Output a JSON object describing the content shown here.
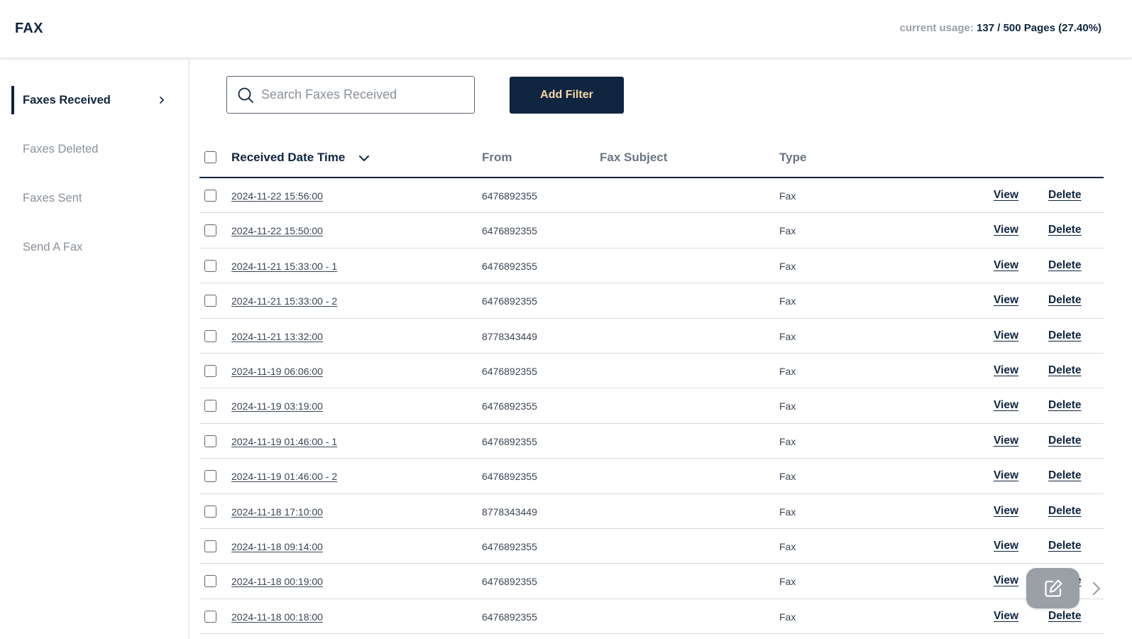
{
  "header": {
    "title": "FAX",
    "usage_label": "current usage:",
    "usage_value": "137 / 500 Pages (27.40%)",
    "usage_used_pages": 137,
    "usage_total_pages": 500
  },
  "sidebar": {
    "items": [
      {
        "label": "Faxes Received",
        "active": true,
        "icon": "chevron-right-icon"
      },
      {
        "label": "Faxes Deleted",
        "active": false
      },
      {
        "label": "Faxes Sent",
        "active": false
      },
      {
        "label": "Send A Fax",
        "active": false
      }
    ]
  },
  "toolbar": {
    "search_placeholder": "Search Faxes Received",
    "search_value": "",
    "search_icon": "search-icon",
    "add_filter_label": "Add Filter"
  },
  "table": {
    "columns": {
      "date": "Received Date Time",
      "from": "From",
      "subject": "Fax Subject",
      "type": "Type"
    },
    "sort_icon": "chevron-down-icon",
    "action_view": "View",
    "action_delete": "Delete",
    "rows": [
      {
        "date": "2024-11-22 15:56:00",
        "from": "6476892355",
        "subject": "",
        "type": "Fax"
      },
      {
        "date": "2024-11-22 15:50:00",
        "from": "6476892355",
        "subject": "",
        "type": "Fax"
      },
      {
        "date": "2024-11-21 15:33:00 - 1",
        "from": "6476892355",
        "subject": "",
        "type": "Fax"
      },
      {
        "date": "2024-11-21 15:33:00 - 2",
        "from": "6476892355",
        "subject": "",
        "type": "Fax"
      },
      {
        "date": "2024-11-21 13:32:00",
        "from": "8778343449",
        "subject": "",
        "type": "Fax"
      },
      {
        "date": "2024-11-19 06:06:00",
        "from": "6476892355",
        "subject": "",
        "type": "Fax"
      },
      {
        "date": "2024-11-19 03:19:00",
        "from": "6476892355",
        "subject": "",
        "type": "Fax"
      },
      {
        "date": "2024-11-19 01:46:00 - 1",
        "from": "6476892355",
        "subject": "",
        "type": "Fax"
      },
      {
        "date": "2024-11-19 01:46:00 - 2",
        "from": "6476892355",
        "subject": "",
        "type": "Fax"
      },
      {
        "date": "2024-11-18 17:10:00",
        "from": "8778343449",
        "subject": "",
        "type": "Fax"
      },
      {
        "date": "2024-11-18 09:14:00",
        "from": "6476892355",
        "subject": "",
        "type": "Fax"
      },
      {
        "date": "2024-11-18 00:19:00",
        "from": "6476892355",
        "subject": "",
        "type": "Fax"
      },
      {
        "date": "2024-11-18 00:18:00",
        "from": "6476892355",
        "subject": "",
        "type": "Fax"
      }
    ]
  },
  "floating": {
    "compose_icon": "edit-icon",
    "expand_icon": "chevron-right-icon"
  },
  "colors": {
    "brand_navy": "#0f2540",
    "button_text": "#f4d9a6",
    "muted_text": "#8a919b",
    "fab_bg": "#9aa0a6"
  }
}
